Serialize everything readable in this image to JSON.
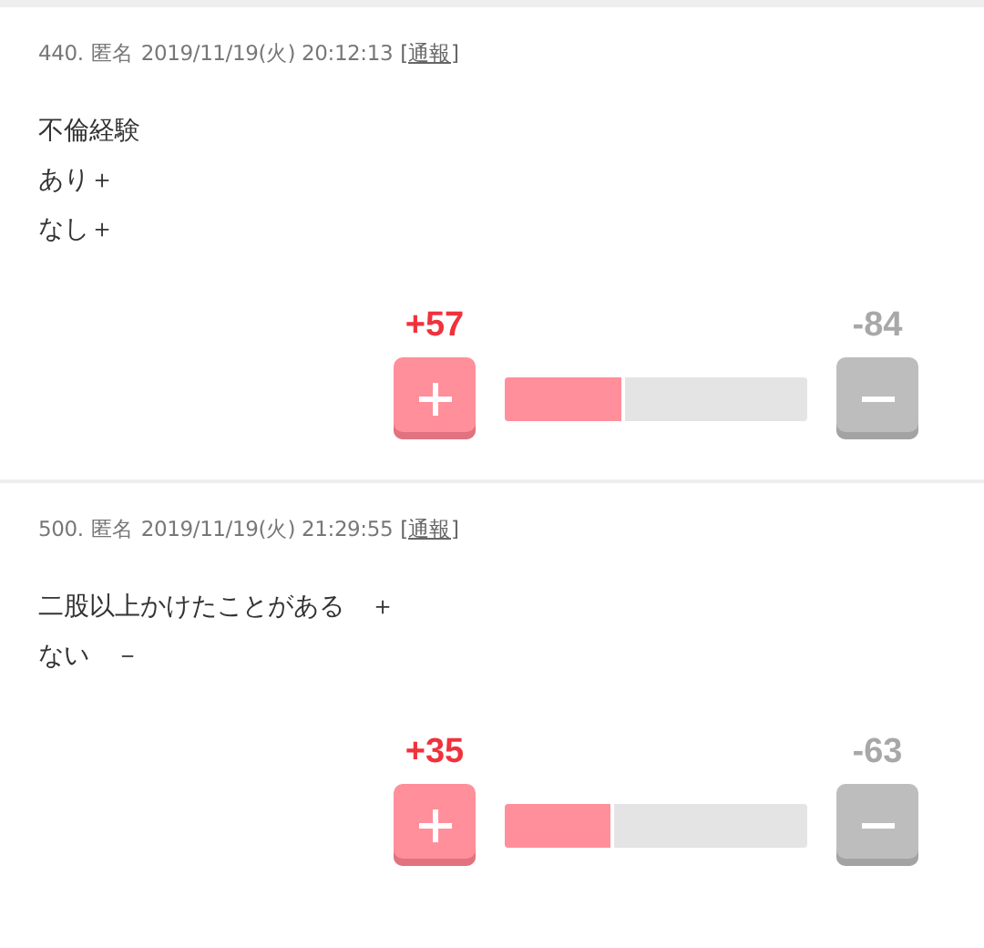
{
  "posts": [
    {
      "number": "440.",
      "name": "匿名",
      "datetime": "2019/11/19(火) 20:12:13",
      "report": "[通報]",
      "lines": [
        "不倫経験",
        "あり＋",
        "なし＋"
      ],
      "plus": "+57",
      "minus": "-84",
      "level": 0.4
    },
    {
      "number": "500.",
      "name": "匿名",
      "datetime": "2019/11/19(火) 21:29:55",
      "report": "[通報]",
      "lines": [
        "二股以上かけたことがある　＋",
        "ない　－"
      ],
      "plus": "+35",
      "minus": "-63",
      "level": 0.36
    }
  ]
}
